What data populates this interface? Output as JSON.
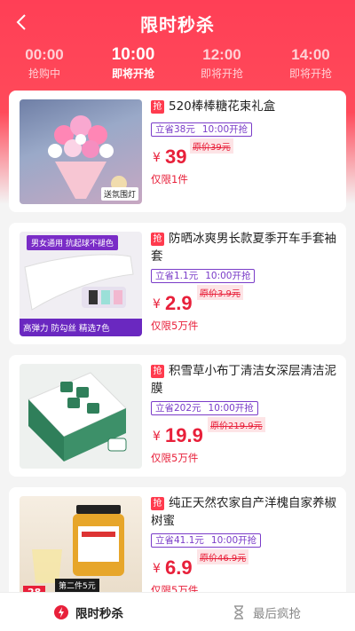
{
  "header": {
    "title": "限时秒杀"
  },
  "tabs": [
    {
      "time": "00:00",
      "status": "抢购中"
    },
    {
      "time": "10:00",
      "status": "即将开抢"
    },
    {
      "time": "12:00",
      "status": "即将开抢"
    },
    {
      "time": "14:00",
      "status": "即将开抢"
    }
  ],
  "products": [
    {
      "tag": "抢",
      "name": "520棒棒糖花束礼盒",
      "save": "立省38元",
      "start": "10:00开抢",
      "currency": "¥",
      "price": "39",
      "original": "原价39元",
      "limit": "仅限1件",
      "thumb_caption": "送氛围灯"
    },
    {
      "tag": "抢",
      "name": "防晒冰爽男长款夏季开车手套袖套",
      "save": "立省1.1元",
      "start": "10:00开抢",
      "currency": "¥",
      "price": "2.9",
      "original": "原价3.9元",
      "limit": "仅限5万件",
      "thumb_top": "男女通用  抗起球不褪色",
      "thumb_bottom": "高弹力  防勾丝  精选7色"
    },
    {
      "tag": "抢",
      "name": "积雪草小布丁清洁女深层清洁泥膜",
      "save": "立省202元",
      "start": "10:00开抢",
      "currency": "¥",
      "price": "19.9",
      "original": "原价219.9元",
      "limit": "仅限5万件"
    },
    {
      "tag": "抢",
      "name": "纯正天然农家自产洋槐自家养椒树蜜",
      "save": "立省41.1元",
      "start": "10:00开抢",
      "currency": "¥",
      "price": "6.9",
      "original": "原价46.9元",
      "limit": "仅限5万件",
      "thumb_label": "第二件5元",
      "thumb_price": "28"
    }
  ],
  "bottom_nav": [
    {
      "label": "限时秒杀",
      "icon": "flash-icon"
    },
    {
      "label": "最后疯抢",
      "icon": "hourglass-icon"
    }
  ],
  "colors": {
    "brand": "#ff3f56",
    "price": "#e8203a",
    "save_border": "#7a3cc8"
  }
}
